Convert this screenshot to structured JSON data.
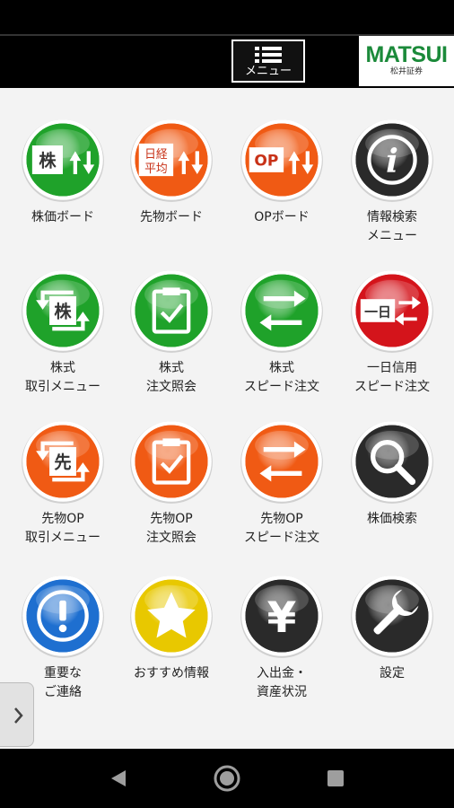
{
  "header": {
    "menu_label": "メニュー",
    "logo_brand": "MATSUI",
    "logo_sub": "松井証券"
  },
  "tiles": [
    {
      "label": "株価ボード",
      "color": "#1fa22a",
      "icon": "kabu-updown-icon",
      "glyph": "株"
    },
    {
      "label": "先物ボード",
      "color": "#f05a14",
      "icon": "nikkei-average-updown-icon",
      "glyph": "日経平均"
    },
    {
      "label": "OPボード",
      "color": "#f05a14",
      "icon": "op-updown-icon",
      "glyph": "OP"
    },
    {
      "label": "情報検索\nメニュー",
      "color": "#2a2a2a",
      "icon": "info-icon",
      "glyph": "i"
    },
    {
      "label": "株式\n取引メニュー",
      "color": "#1fa22a",
      "icon": "kabu-trade-icon",
      "glyph": "株"
    },
    {
      "label": "株式\n注文照会",
      "color": "#1fa22a",
      "icon": "clipboard-check-icon",
      "glyph": ""
    },
    {
      "label": "株式\nスピード注文",
      "color": "#1fa22a",
      "icon": "exchange-arrows-icon",
      "glyph": ""
    },
    {
      "label": "一日信用\nスピード注文",
      "color": "#d4141b",
      "icon": "ichinichi-arrows-icon",
      "glyph": "一日"
    },
    {
      "label": "先物OP\n取引メニュー",
      "color": "#f05a14",
      "icon": "saki-trade-icon",
      "glyph": "先"
    },
    {
      "label": "先物OP\n注文照会",
      "color": "#f05a14",
      "icon": "clipboard-check-icon",
      "glyph": ""
    },
    {
      "label": "先物OP\nスピード注文",
      "color": "#f05a14",
      "icon": "exchange-arrows-icon",
      "glyph": ""
    },
    {
      "label": "株価検索",
      "color": "#2a2a2a",
      "icon": "search-icon",
      "glyph": ""
    },
    {
      "label": "重要な\nご連絡",
      "color": "#1e6fd0",
      "icon": "exclamation-icon",
      "glyph": "!"
    },
    {
      "label": "おすすめ情報",
      "color": "#e8c800",
      "icon": "star-icon",
      "glyph": ""
    },
    {
      "label": "入出金・\n資産状況",
      "color": "#2a2a2a",
      "icon": "yen-icon",
      "glyph": "¥"
    },
    {
      "label": "設定",
      "color": "#2a2a2a",
      "icon": "wrench-icon",
      "glyph": ""
    }
  ]
}
